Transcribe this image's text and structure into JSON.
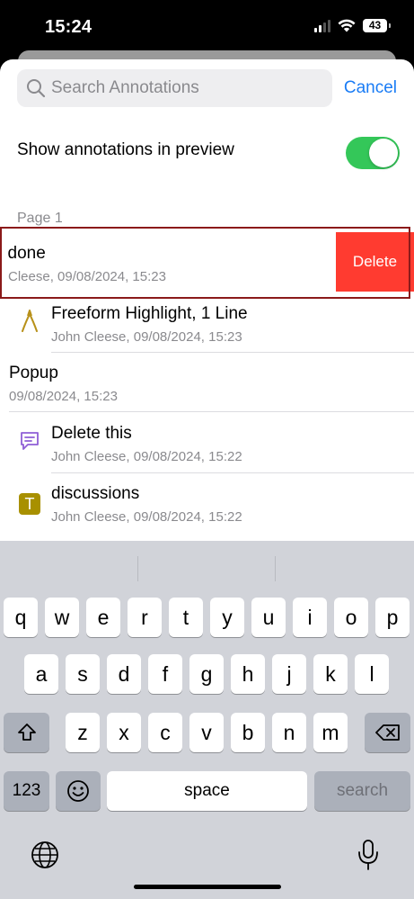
{
  "status_bar": {
    "time": "15:24",
    "battery": "43"
  },
  "search": {
    "placeholder": "Search Annotations",
    "cancel_label": "Cancel"
  },
  "preferences": {
    "show_in_preview_label": "Show annotations in preview",
    "show_in_preview_on": true
  },
  "section": {
    "title": "Page 1"
  },
  "annotations": [
    {
      "title": "l done",
      "subtitle": "Cleese, 09/08/2024, 15:23",
      "icon": "none",
      "swipe_action": "Delete"
    },
    {
      "title": "Freeform Highlight, 1 Line",
      "subtitle": "John Cleese, 09/08/2024, 15:23",
      "icon": "freeform-highlight-icon"
    },
    {
      "title": "Popup",
      "subtitle": "09/08/2024, 15:23",
      "icon": "none"
    },
    {
      "title": "Delete this",
      "subtitle": "John Cleese, 09/08/2024, 15:22",
      "icon": "note-comment-icon"
    },
    {
      "title": "discussions",
      "subtitle": "John Cleese, 09/08/2024, 15:22",
      "icon": "text-T-icon"
    }
  ],
  "keyboard": {
    "row1": [
      "q",
      "w",
      "e",
      "r",
      "t",
      "y",
      "u",
      "i",
      "o",
      "p"
    ],
    "row2": [
      "a",
      "s",
      "d",
      "f",
      "g",
      "h",
      "j",
      "k",
      "l"
    ],
    "row3": [
      "z",
      "x",
      "c",
      "v",
      "b",
      "n",
      "m"
    ],
    "numbers_key": "123",
    "space_key": "space",
    "return_key": "search"
  },
  "colors": {
    "accent": "#1a7cf5",
    "toggle_on": "#34c759",
    "delete": "#ff3b30",
    "highlight_icon": "#b8911a",
    "note_icon": "#8f5ed6",
    "text_icon": "#a89000"
  }
}
